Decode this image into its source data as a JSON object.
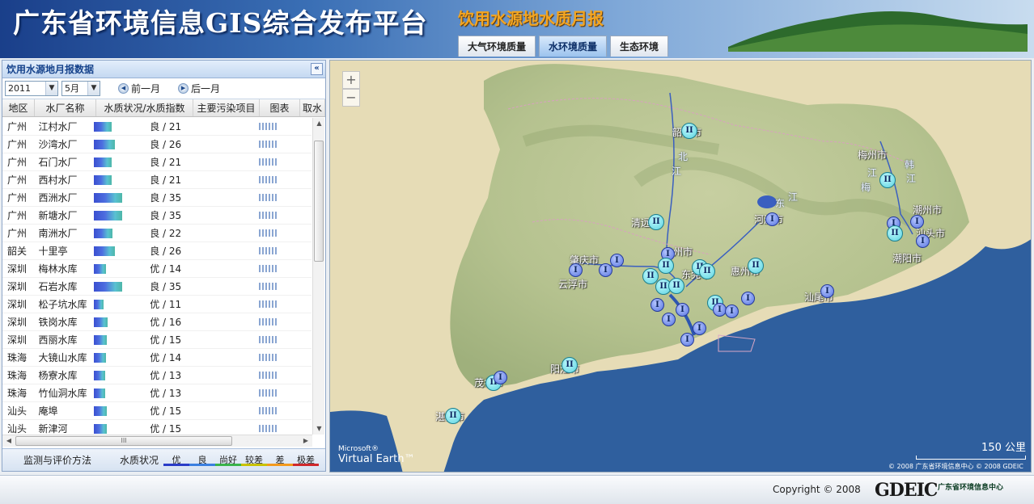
{
  "header": {
    "brand": "广东省环境信息GIS综合发布平台",
    "subtitle": "饮用水源地水质月报",
    "tabs": [
      {
        "label": "大气环境质量",
        "active": false
      },
      {
        "label": "水环境质量",
        "active": true
      },
      {
        "label": "生态环境",
        "active": false
      }
    ]
  },
  "panel": {
    "title": "饮用水源地月报数据",
    "collapse_icon": "«",
    "year": "2011",
    "month": "5月",
    "prev_label": "前一月",
    "next_label": "后一月",
    "columns": [
      "地区",
      "水厂名称",
      "水质状况/水质指数",
      "主要污染项目",
      "图表",
      "取水"
    ],
    "rows": [
      {
        "region": "广州",
        "plant": "江村水厂",
        "level": "良",
        "index": "/ 21",
        "value": 21
      },
      {
        "region": "广州",
        "plant": "沙湾水厂",
        "level": "良",
        "index": "/ 26",
        "value": 26
      },
      {
        "region": "广州",
        "plant": "石门水厂",
        "level": "良",
        "index": "/ 21",
        "value": 21
      },
      {
        "region": "广州",
        "plant": "西村水厂",
        "level": "良",
        "index": "/ 21",
        "value": 21
      },
      {
        "region": "广州",
        "plant": "西洲水厂",
        "level": "良",
        "index": "/ 35",
        "value": 35
      },
      {
        "region": "广州",
        "plant": "新塘水厂",
        "level": "良",
        "index": "/ 35",
        "value": 35
      },
      {
        "region": "广州",
        "plant": "南洲水厂",
        "level": "良",
        "index": "/ 22",
        "value": 22
      },
      {
        "region": "韶关",
        "plant": "十里亭",
        "level": "良",
        "index": "/ 26",
        "value": 26
      },
      {
        "region": "深圳",
        "plant": "梅林水库",
        "level": "优",
        "index": "/ 14",
        "value": 14
      },
      {
        "region": "深圳",
        "plant": "石岩水库",
        "level": "良",
        "index": "/ 35",
        "value": 35
      },
      {
        "region": "深圳",
        "plant": "松子坑水库",
        "level": "优",
        "index": "/ 11",
        "value": 11
      },
      {
        "region": "深圳",
        "plant": "铁岗水库",
        "level": "优",
        "index": "/ 16",
        "value": 16
      },
      {
        "region": "深圳",
        "plant": "西丽水库",
        "level": "优",
        "index": "/ 15",
        "value": 15
      },
      {
        "region": "珠海",
        "plant": "大镜山水库",
        "level": "优",
        "index": "/ 14",
        "value": 14
      },
      {
        "region": "珠海",
        "plant": "杨寮水库",
        "level": "优",
        "index": "/ 13",
        "value": 13
      },
      {
        "region": "珠海",
        "plant": "竹仙洞水库",
        "level": "优",
        "index": "/ 13",
        "value": 13
      },
      {
        "region": "汕头",
        "plant": "庵埠",
        "level": "优",
        "index": "/ 15",
        "value": 15
      },
      {
        "region": "汕头",
        "plant": "新津河",
        "level": "优",
        "index": "/ 15",
        "value": 15
      }
    ],
    "hscroll_grip": "III",
    "footer": {
      "method_label": "监测与评价方法",
      "quality_label": "水质状况",
      "legend": [
        {
          "label": "优",
          "color": "#2a3cc8"
        },
        {
          "label": "良",
          "color": "#3a7fe0"
        },
        {
          "label": "尚好",
          "color": "#39b54a"
        },
        {
          "label": "较差",
          "color": "#c9c200"
        },
        {
          "label": "差",
          "color": "#f39a1e"
        },
        {
          "label": "极差",
          "color": "#d0282b"
        }
      ]
    }
  },
  "map": {
    "zoom_in": "+",
    "zoom_out": "−",
    "cities": [
      {
        "name": "韶关市"
      },
      {
        "name": "梅州市"
      },
      {
        "name": "河源市"
      },
      {
        "name": "潮州市"
      },
      {
        "name": "汕头市"
      },
      {
        "name": "潮阳市"
      },
      {
        "name": "清远市"
      },
      {
        "name": "肇庆市"
      },
      {
        "name": "云浮市"
      },
      {
        "name": "广州市"
      },
      {
        "name": "东莞市"
      },
      {
        "name": "惠州市"
      },
      {
        "name": "汕尾市"
      },
      {
        "name": "阳江市"
      },
      {
        "name": "茂名市"
      },
      {
        "name": "湛江市"
      }
    ],
    "rivers": [
      "北",
      "江",
      "东",
      "江",
      "梅",
      "江",
      "韩",
      "江"
    ],
    "brand": "Microsoft®",
    "brand2": "Virtual Earth™",
    "scale": "150 公里",
    "copyright": "© 2008 广东省环境信息中心   © 2008 GDEIC",
    "sites_label_grade1": "I",
    "sites_label_grade2": "II"
  },
  "footer": {
    "copyright": "Copyright © 2008",
    "logo": "GDEIC",
    "logo_sub": "广东省环境信息中心"
  }
}
